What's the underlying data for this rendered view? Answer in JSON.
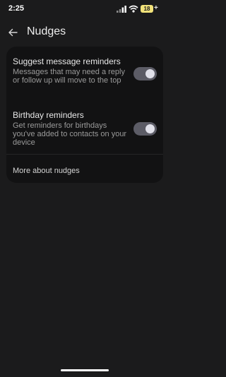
{
  "status_bar": {
    "time": "2:25",
    "battery_level": "18",
    "battery_charging_symbol": "+",
    "battery_color": "#f2e27a",
    "icons": [
      "signal-icon",
      "wifi-icon",
      "battery-icon"
    ]
  },
  "header": {
    "back_icon": "arrow-left-icon",
    "title": "Nudges"
  },
  "settings": {
    "items": [
      {
        "title": "Suggest message reminders",
        "description": "Messages that may need a reply or follow up will move to the top",
        "enabled": true
      },
      {
        "title": "Birthday reminders",
        "description": "Get reminders for birthdays you've added to contacts on your device",
        "enabled": true
      }
    ],
    "more_link": "More about nudges"
  },
  "colors": {
    "background": "#1b1b1c",
    "card": "#121213",
    "toggle_track": "#5c5c66",
    "toggle_knob": "#e1e1ea"
  }
}
